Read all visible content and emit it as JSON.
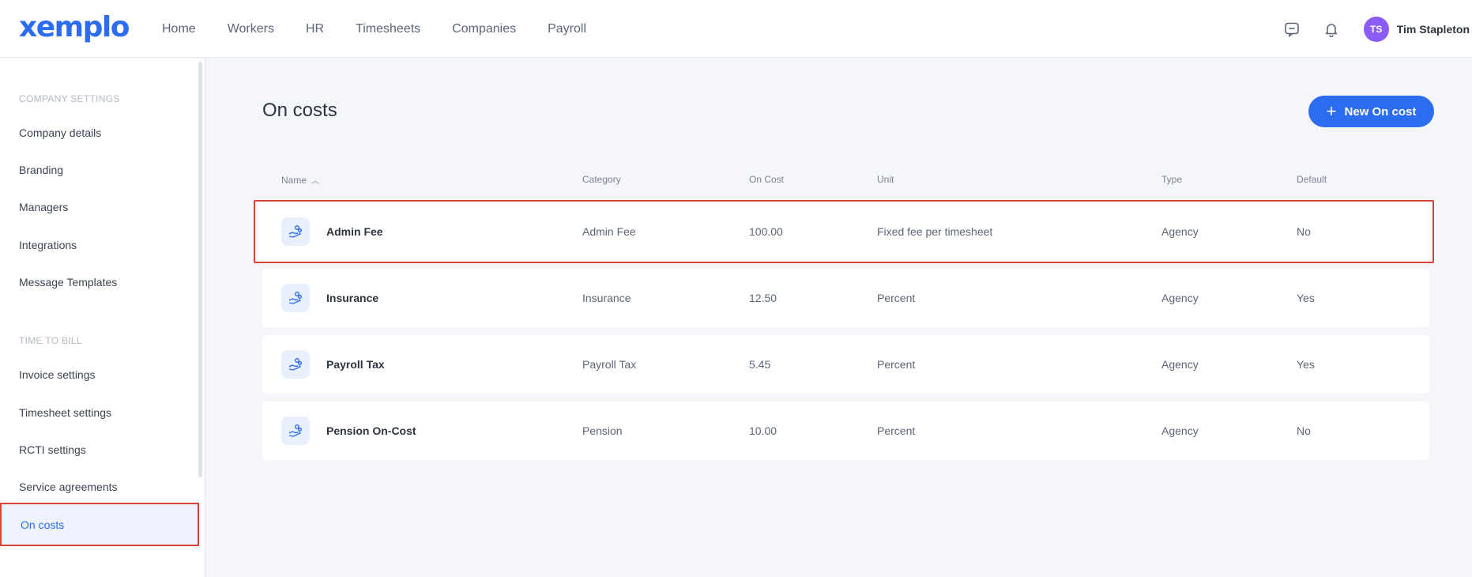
{
  "app": {
    "logo": "xemplo",
    "nav": [
      "Home",
      "Workers",
      "HR",
      "Timesheets",
      "Companies",
      "Payroll"
    ],
    "user": {
      "initials": "TS",
      "name": "Tim Stapleton"
    },
    "accent": "#2b6cf0"
  },
  "sidebar": {
    "company_settings_heading": "COMPANY SETTINGS",
    "company_items": [
      "Company details",
      "Branding",
      "Managers",
      "Integrations",
      "Message Templates"
    ],
    "time_to_bill_heading": "TIME TO BILL",
    "time_items": [
      "Invoice settings",
      "Timesheet settings",
      "RCTI settings",
      "Service agreements",
      "On costs"
    ],
    "active_item": "On costs"
  },
  "main": {
    "title": "On costs",
    "new_button_label": "New On cost",
    "columns": [
      "Name",
      "Category",
      "On Cost",
      "Unit",
      "Type",
      "Default"
    ],
    "rows": [
      {
        "name": "Admin Fee",
        "category": "Admin Fee",
        "on_cost": "100.00",
        "unit": "Fixed fee per timesheet",
        "type": "Agency",
        "default": "No"
      },
      {
        "name": "Insurance",
        "category": "Insurance",
        "on_cost": "12.50",
        "unit": "Percent",
        "type": "Agency",
        "default": "Yes"
      },
      {
        "name": "Payroll Tax",
        "category": "Payroll Tax",
        "on_cost": "5.45",
        "unit": "Percent",
        "type": "Agency",
        "default": "Yes"
      },
      {
        "name": "Pension On-Cost",
        "category": "Pension",
        "on_cost": "10.00",
        "unit": "Percent",
        "type": "Agency",
        "default": "No"
      }
    ]
  }
}
